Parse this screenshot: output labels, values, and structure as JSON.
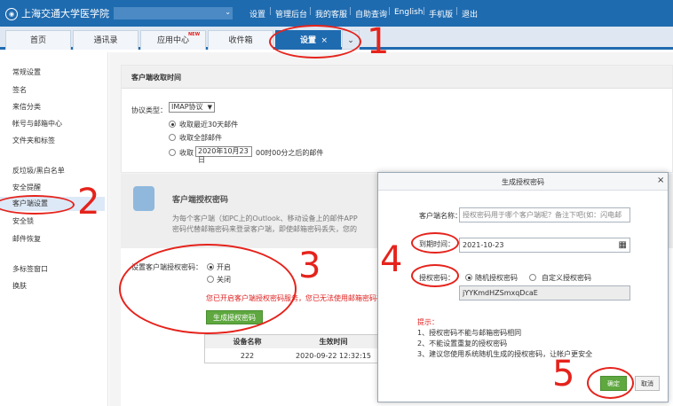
{
  "header": {
    "logo_text": "上海交通大学医学院",
    "links": [
      "设置",
      "管理后台",
      "我的客服",
      "自助查询",
      "English",
      "手机版",
      "退出"
    ]
  },
  "tabs": [
    {
      "label": "首页"
    },
    {
      "label": "通讯录"
    },
    {
      "label": "应用中心",
      "badge": "NEW"
    },
    {
      "label": "收件箱"
    },
    {
      "label": "设置",
      "close": "×",
      "active": true
    }
  ],
  "tab_more": "⌄",
  "sidebar": {
    "items": [
      "常规设置",
      "签名",
      "来信分类",
      "帐号与邮箱中心",
      "文件夹和标签",
      "反垃圾/黑白名单",
      "安全提醒",
      "客户端设置",
      "安全锁",
      "邮件恢复",
      "多标签窗口",
      "换肤"
    ],
    "active_index": 7
  },
  "client_receive": {
    "title": "客户端收取时间",
    "protocol_label": "协议类型：",
    "protocol_value": "IMAP协议",
    "options": [
      "收取最近30天邮件",
      "收取全部邮件"
    ],
    "custom_prefix": "收取",
    "custom_date": "2020年10月23日",
    "custom_suffix": "00时00分之后的邮件"
  },
  "auth_code_section": {
    "title": "客户端授权密码",
    "desc_line1": "为每个客户端（如PC上的Outlook、移动设备上的邮件APP",
    "desc_line2": "密码代替邮箱密码来登录客户端，即使邮箱密码丢失，您的"
  },
  "auth_setting": {
    "label": "设置客户端授权密码：",
    "on": "开启",
    "off": "关闭",
    "warning": "您已开启客户端授权密码服务，您已无法使用邮箱密码在客",
    "generate_button": "生成授权密码",
    "table": {
      "headers": [
        "设备名称",
        "生效时间"
      ],
      "rows": [
        [
          "222",
          "2020-09-22 12:32:15"
        ]
      ]
    }
  },
  "dialog": {
    "title": "生成授权密码",
    "close": "×",
    "client_name_label": "客户端名称：",
    "client_name_placeholder": "授权密码用于哪个客户端呢？备注下吧(如：闪电邮",
    "expire_label": "到期时间：",
    "expire_value": "2021-10-23",
    "code_label": "授权密码：",
    "code_option_random": "随机授权密码",
    "code_option_custom": "自定义授权密码",
    "code_value": "jYYKmdHZSmxqDcaE",
    "tips_title": "提示：",
    "tips": [
      "1、授权密码不能与邮箱密码相同",
      "2、不能设置重复的授权密码",
      "3、建议您使用系统随机生成的授权密码，让帐户更安全"
    ],
    "ok_button": "确定",
    "cancel_button": "取消"
  },
  "annotations": [
    "1",
    "2",
    "3",
    "4",
    "5"
  ],
  "colors": {
    "accent": "#1f6bb0",
    "annotation": "#e5231c",
    "button_green": "#5ea83f"
  }
}
